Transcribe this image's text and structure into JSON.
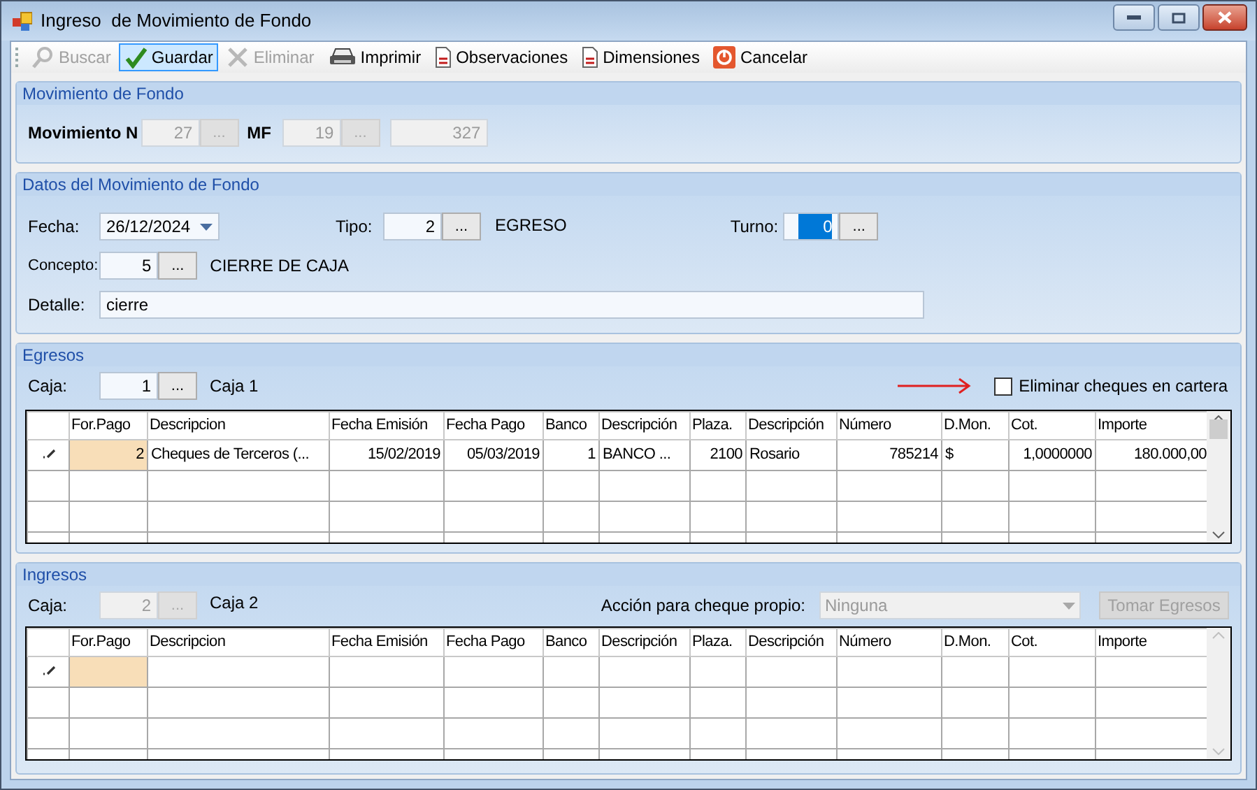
{
  "window": {
    "title": "Ingreso  de Movimiento de Fondo"
  },
  "toolbar": [
    {
      "kind": "search",
      "label": "Buscar",
      "disabled": true,
      "selected": false
    },
    {
      "kind": "check",
      "label": "Guardar",
      "disabled": false,
      "selected": true
    },
    {
      "kind": "delete",
      "label": "Eliminar",
      "disabled": true,
      "selected": false
    },
    {
      "kind": "print",
      "label": "Imprimir",
      "disabled": false,
      "selected": false
    },
    {
      "kind": "document",
      "label": "Observaciones",
      "disabled": false,
      "selected": false
    },
    {
      "kind": "document",
      "label": "Dimensiones",
      "disabled": false,
      "selected": false
    },
    {
      "kind": "cancel",
      "label": "Cancelar",
      "disabled": false,
      "selected": false
    }
  ],
  "movimiento": {
    "title": "Movimiento de Fondo",
    "numero_label": "Movimiento N",
    "numero": {
      "value": "27",
      "disabled": true
    },
    "numero_button": "...",
    "mf_label": "MF",
    "mf": {
      "value": "19",
      "disabled": true
    },
    "mf_button": "...",
    "total": {
      "value": "327",
      "disabled": true
    }
  },
  "datos": {
    "title": "Datos del Movimiento de Fondo",
    "fecha_label": "Fecha:",
    "fecha": "26/12/2024",
    "tipo_label": "Tipo:",
    "tipo": {
      "value": "2",
      "disabled": false
    },
    "tipo_button": "...",
    "tipo_text": "EGRESO",
    "turno_label": "Turno:",
    "turno": {
      "value": "0",
      "disabled": false,
      "selected": true
    },
    "turno_button": "...",
    "concepto_label": "Concepto:",
    "concepto": {
      "value": "5",
      "disabled": false
    },
    "concepto_button": "...",
    "concepto_text": "CIERRE DE CAJA",
    "detalle_label": "Detalle:",
    "detalle": {
      "value": "cierre",
      "disabled": false
    }
  },
  "egresos": {
    "title": "Egresos",
    "caja_label": "Caja:",
    "caja": {
      "value": "1",
      "disabled": false
    },
    "caja_button": "...",
    "caja_text": "Caja 1",
    "eliminar_cheques": {
      "label": "Eliminar cheques en cartera",
      "checked": false
    },
    "table": {
      "columns": [
        "For.Pago",
        "Descripcion",
        "Fecha Emisión",
        "Fecha Pago",
        "Banco",
        "Descripción",
        "Plaza.",
        "Descripción",
        "Número",
        "D.Mon.",
        "Cot.",
        "Importe"
      ],
      "rows": [
        {
          "editing": true,
          "cells": [
            "2",
            "Cheques de Terceros (...",
            "15/02/2019",
            "05/03/2019",
            "1",
            "BANCO ...",
            "2100",
            "Rosario",
            "785214",
            "$",
            "1,0000000",
            "180.000,00"
          ]
        }
      ]
    }
  },
  "ingresos": {
    "title": "Ingresos",
    "caja_label": "Caja:",
    "caja": {
      "value": "2",
      "disabled": true
    },
    "caja_button": "...",
    "caja_text": "Caja 2",
    "accion_label": "Acción para cheque propio:",
    "accion": {
      "value": "Ninguna",
      "disabled": true
    },
    "tomar_egresos": {
      "label": "Tomar Egresos",
      "disabled": true
    },
    "table": {
      "columns": [
        "For.Pago",
        "Descripcion",
        "Fecha Emisión",
        "Fecha Pago",
        "Banco",
        "Descripción",
        "Plaza.",
        "Descripción",
        "Número",
        "D.Mon.",
        "Cot.",
        "Importe"
      ],
      "rows": [
        {
          "editing": true
        }
      ]
    }
  }
}
